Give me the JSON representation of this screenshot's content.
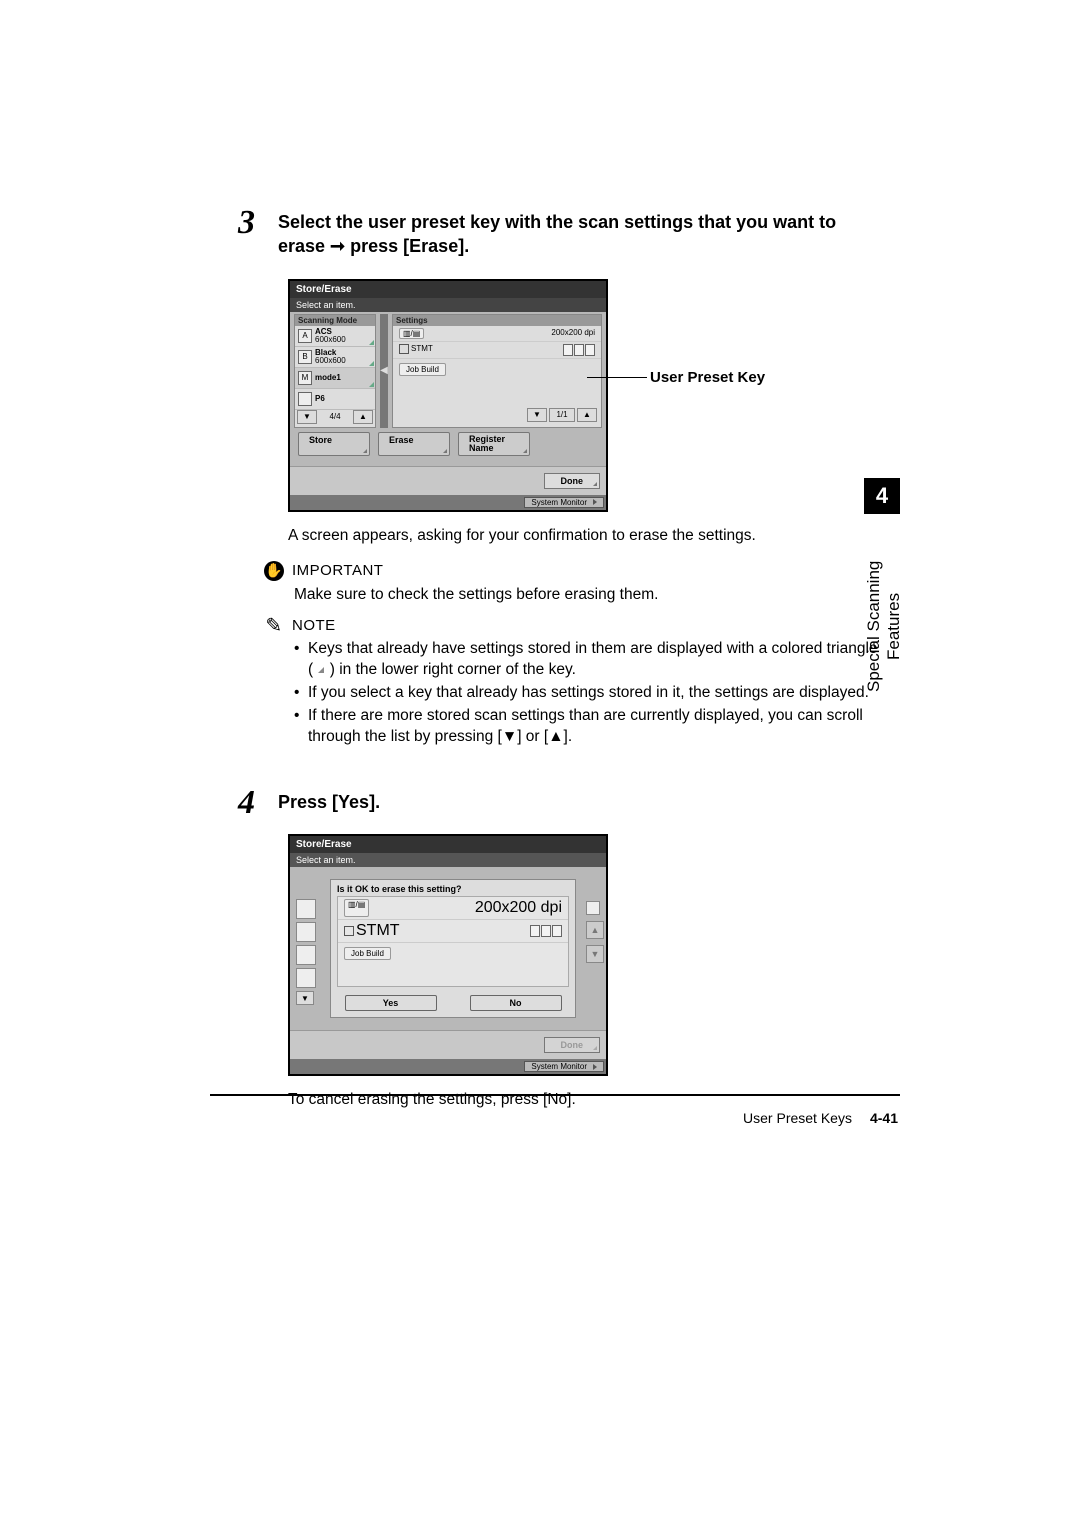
{
  "step3": {
    "number": "3",
    "heading": "Select the user preset key with the scan settings that you want to erase ➞ press [Erase].",
    "callout": "User Preset Key",
    "after_text": "A screen appears, asking for your confirmation to erase the settings.",
    "important_label": "IMPORTANT",
    "important_text": "Make sure to check the settings before erasing them.",
    "note_label": "NOTE",
    "note_bullets": [
      "Keys that already have settings stored in them are displayed with a colored triangle ( ",
      " ) in the lower right corner of the key.",
      "If you select a key that already has settings stored in it, the settings are displayed.",
      "If there are more stored scan settings than are currently displayed, you can scroll through the list by pressing [▼] or [▲]."
    ]
  },
  "fig1": {
    "title": "Store/Erase",
    "subtitle": "Select an item.",
    "left_header": "Scanning Mode",
    "right_header": "Settings",
    "presets": [
      {
        "name": "ACS",
        "sub": "600x600",
        "icon": "A",
        "stored": true
      },
      {
        "name": "Black",
        "sub": "600x600",
        "icon": "B",
        "stored": true
      },
      {
        "name": "mode1",
        "sub": "",
        "icon": "M",
        "stored": true
      },
      {
        "name": "P6",
        "sub": "",
        "icon": "",
        "stored": false
      }
    ],
    "left_page": "4/4",
    "settings": {
      "row1_left": "▥/▤",
      "row1_right": "200x200 dpi",
      "row2_left": "STMT",
      "row2_right_icons": true,
      "job_build": "Job Build"
    },
    "pager": {
      "page": "1/1"
    },
    "buttons": {
      "store": "Store",
      "erase": "Erase",
      "register": "Register\nName"
    },
    "done": "Done",
    "sysmon": "System Monitor"
  },
  "step4": {
    "number": "4",
    "heading": "Press [Yes].",
    "after_text": "To cancel erasing the settings, press [No]."
  },
  "fig2": {
    "title": "Store/Erase",
    "subtitle": "Select an item.",
    "question": "Is it OK to erase this setting?",
    "settings": {
      "row1_left": "▥/▤",
      "row1_right": "200x200 dpi",
      "row2_left": "STMT",
      "job_build": "Job Build"
    },
    "yes": "Yes",
    "no": "No",
    "done": "Done",
    "sysmon": "System Monitor"
  },
  "side": {
    "chapter": "4",
    "label": "Special Scanning Features"
  },
  "footer": {
    "section": "User Preset Keys",
    "page": "4-41"
  }
}
